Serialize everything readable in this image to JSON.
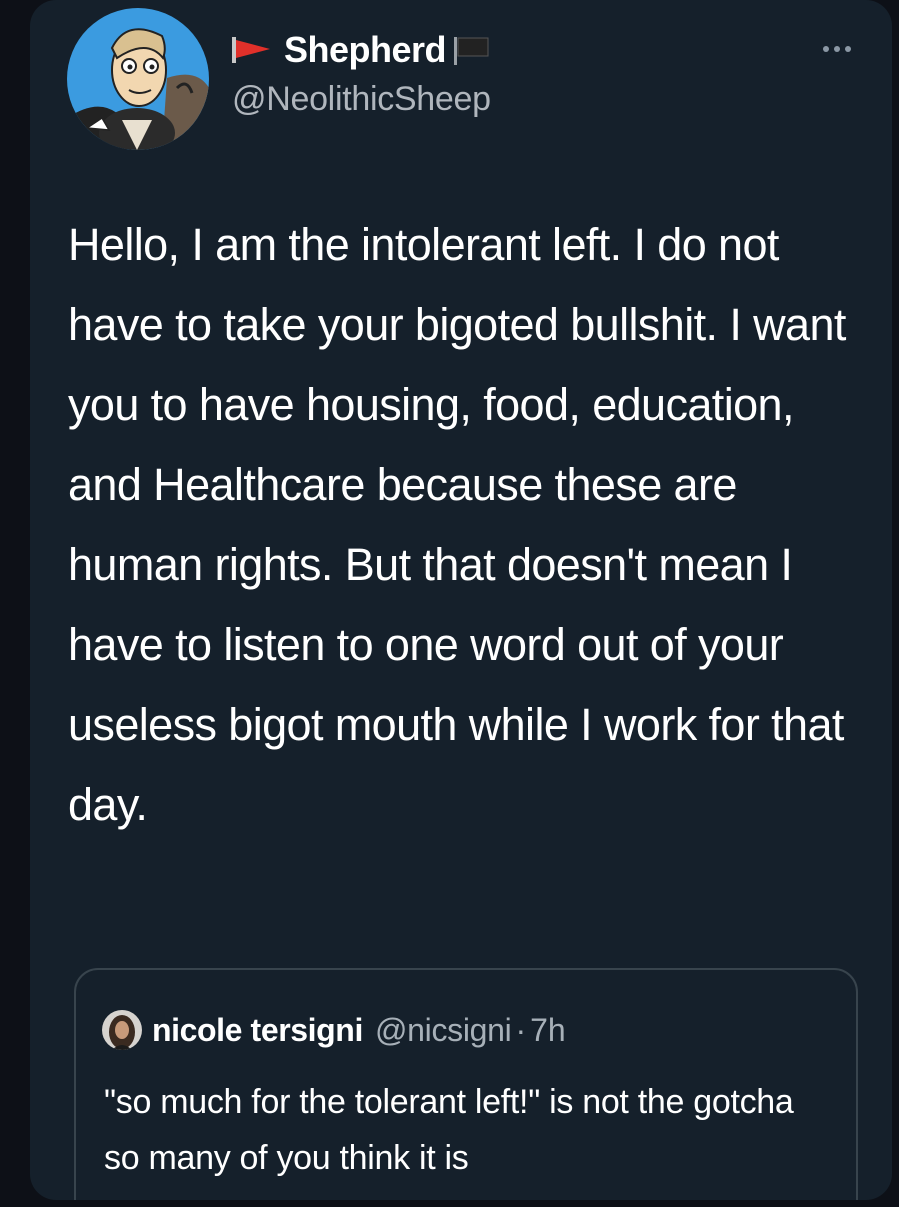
{
  "tweet": {
    "display_name": "Shepherd",
    "handle": "@NeolithicSheep",
    "avatar_icon": "cartoon-avatar-icon",
    "flag_icon": "red-flag-icon",
    "name_suffix_icon": "black-flag-icon",
    "more_icon": "more-options-icon",
    "body": "Hello, I am the intolerant left. I do not have to take your bigoted bullshit. I want you to have housing, food, education, and Healthcare because these are human rights. But that doesn't mean I have to listen to one word out of your useless bigot mouth while I work for that day."
  },
  "quoted_tweet": {
    "display_name": "nicole tersigni",
    "handle": "@nicsigni",
    "separator": "·",
    "time": "7h",
    "body": "\"so much for the tolerant left!\" is not the gotcha so many of you think it is"
  },
  "colors": {
    "card_background": "#15202b",
    "text_primary": "#ffffff",
    "text_secondary": "#b0b6bd",
    "border": "#38444d",
    "flag_red": "#e0302a"
  }
}
